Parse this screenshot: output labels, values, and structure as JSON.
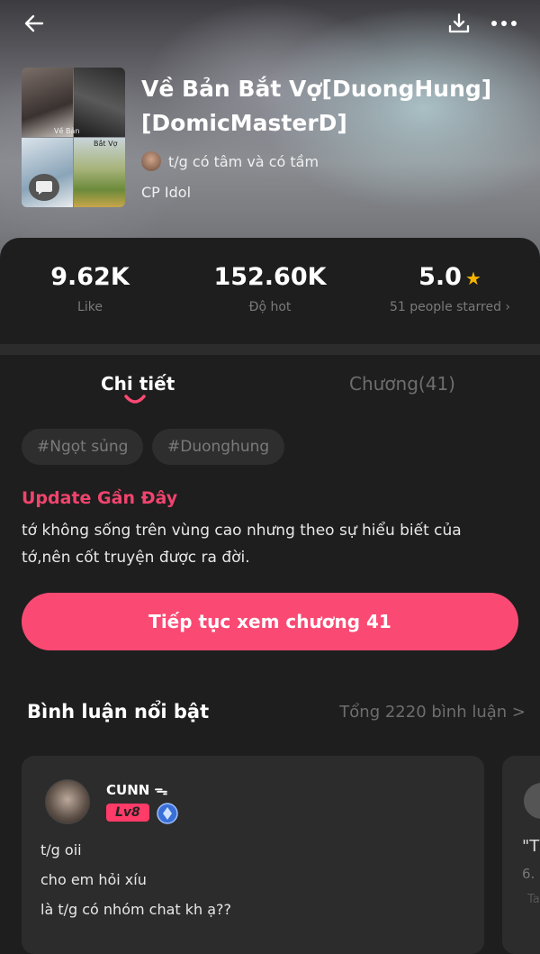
{
  "header": {
    "back_icon": "back-arrow-icon",
    "download_icon": "download-icon",
    "more_icon": "more-icon"
  },
  "book": {
    "title": "Về Bản Bắt Vợ[DuongHung][DomicMasterD]",
    "author": "t/g có tâm và có tầm",
    "category": "CP Idol",
    "cover_text_1": "Về Bản",
    "cover_text_2": "Bắt Vợ"
  },
  "stats": {
    "likes": "9.62K",
    "likes_label": "Like",
    "hot": "152.60K",
    "hot_label": "Độ hot",
    "rating": "5.0",
    "rating_label": "51 people starred",
    "rating_chevron": "›"
  },
  "tabs": {
    "detail": "Chi tiết",
    "chapters": "Chương(41)"
  },
  "tags": [
    "#Ngọt sủng",
    "#Duonghung"
  ],
  "update": {
    "title": "Update Gần Đây",
    "text": "tớ không sống trên vùng cao nhưng theo sự hiểu biết của tớ,nên cốt truyện được ra đời."
  },
  "continue_button": "Tiếp tục xem chương 41",
  "comments": {
    "title": "Bình luận nổi bật",
    "total": "Tổng 2220 bình luận >",
    "items": [
      {
        "name": "CUNN ᯓ",
        "level": "Lv8",
        "lines": [
          "t/g oii",
          "cho em hỏi xíu",
          "là t/g có nhóm chat kh ạ??"
        ]
      },
      {
        "line1": "\"T",
        "line2": "6.",
        "line3": "Ta"
      }
    ]
  },
  "colors": {
    "accent": "#fa4a73",
    "update_title": "#f0446e",
    "star": "#f5b400",
    "background": "#1e1e1e"
  }
}
